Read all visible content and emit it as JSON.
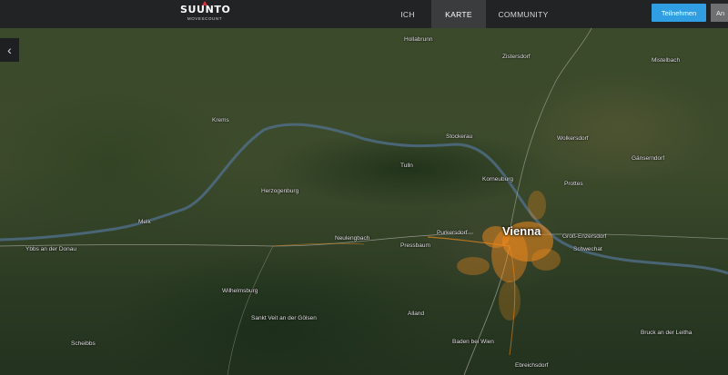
{
  "header": {
    "logo_brand": "SUUNTO",
    "logo_sub": "MOVESCOUNT",
    "nav": [
      "ICH",
      "KARTE",
      "COMMUNITY"
    ],
    "active_nav": "KARTE",
    "join_label": "Teilnehmen",
    "login_label": "An"
  },
  "map": {
    "places": [
      "Vienna",
      "Krems",
      "Tulln",
      "Purkersdorf",
      "Pressbaum",
      "Neulengbach",
      "Herzogenburg",
      "Wilhelmsburg",
      "Sankt Veit an der Gölsen",
      "Alland",
      "Baden bei Wien",
      "Scheibbs",
      "Ybbs an der Donau",
      "Melk",
      "Mistelbach",
      "Hollabrunn",
      "Stockerau",
      "Korneuburg",
      "Wolkersdorf",
      "Gänserndorf",
      "Schwechat",
      "Bruck an der Leitha",
      "Ebreichsdorf",
      "Zistersdorf",
      "Prottes",
      "Groß-Enzersdorf"
    ],
    "colors": {
      "activity": "#f08a1c",
      "water": "#4f6f8f"
    }
  }
}
